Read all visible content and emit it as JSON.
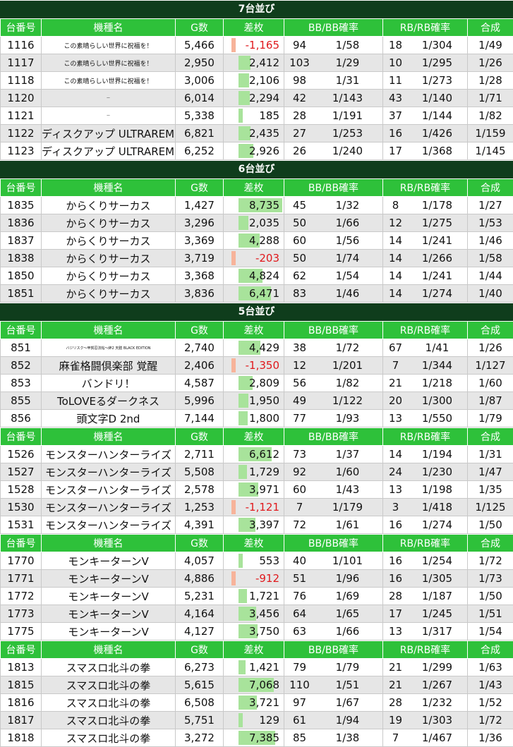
{
  "headers": {
    "no": "台番号",
    "name": "機種名",
    "games": "G数",
    "diff": "差枚",
    "bb": "BB/BB確率",
    "rb": "RB/RB確率",
    "total": "合成"
  },
  "colors": {
    "header_green": "#2ec13a",
    "section_dark": "#0f3d1c",
    "positive_bar": "#a8e39b",
    "negative_bar": "#f7b39a",
    "negative_text": "#e0181c"
  },
  "diff_scale_max": 8735,
  "sections": [
    {
      "title": "7台並び",
      "groups": [
        {
          "rows": [
            {
              "no": "1116",
              "name": "この素晴らしい世界に祝福を！",
              "size": "small",
              "g": "5,466",
              "diff": "-1,165",
              "bb": "94",
              "bbr": "1/58",
              "rb": "18",
              "rbr": "1/304",
              "tot": "1/49"
            },
            {
              "no": "1117",
              "name": "この素晴らしい世界に祝福を！",
              "size": "small",
              "g": "2,950",
              "diff": "2,412",
              "bb": "103",
              "bbr": "1/29",
              "rb": "10",
              "rbr": "1/295",
              "tot": "1/26"
            },
            {
              "no": "1118",
              "name": "この素晴らしい世界に祝福を！",
              "size": "small",
              "g": "3,006",
              "diff": "2,106",
              "bb": "98",
              "bbr": "1/31",
              "rb": "11",
              "rbr": "1/273",
              "tot": "1/28"
            },
            {
              "no": "1120",
              "name": "ー",
              "size": "tiny",
              "g": "6,014",
              "diff": "2,294",
              "bb": "42",
              "bbr": "1/143",
              "rb": "43",
              "rbr": "1/140",
              "tot": "1/71"
            },
            {
              "no": "1121",
              "name": "ー",
              "size": "tiny",
              "g": "5,338",
              "diff": "185",
              "bb": "28",
              "bbr": "1/191",
              "rb": "37",
              "rbr": "1/144",
              "tot": "1/82"
            },
            {
              "no": "1122",
              "name": "ディスクアップ ULTRAREMIX",
              "size": "",
              "g": "6,821",
              "diff": "2,435",
              "bb": "27",
              "bbr": "1/253",
              "rb": "16",
              "rbr": "1/426",
              "tot": "1/159"
            },
            {
              "no": "1123",
              "name": "ディスクアップ ULTRAREMIX",
              "size": "",
              "g": "6,252",
              "diff": "2,926",
              "bb": "26",
              "bbr": "1/240",
              "rb": "17",
              "rbr": "1/368",
              "tot": "1/145"
            }
          ]
        }
      ]
    },
    {
      "title": "6台並び",
      "groups": [
        {
          "rows": [
            {
              "no": "1835",
              "name": "からくりサーカス",
              "size": "",
              "g": "1,427",
              "diff": "8,735",
              "bb": "45",
              "bbr": "1/32",
              "rb": "8",
              "rbr": "1/178",
              "tot": "1/27"
            },
            {
              "no": "1836",
              "name": "からくりサーカス",
              "size": "",
              "g": "3,296",
              "diff": "2,035",
              "bb": "50",
              "bbr": "1/66",
              "rb": "12",
              "rbr": "1/275",
              "tot": "1/53"
            },
            {
              "no": "1837",
              "name": "からくりサーカス",
              "size": "",
              "g": "3,369",
              "diff": "4,288",
              "bb": "60",
              "bbr": "1/56",
              "rb": "14",
              "rbr": "1/241",
              "tot": "1/46"
            },
            {
              "no": "1838",
              "name": "からくりサーカス",
              "size": "",
              "g": "3,719",
              "diff": "-203",
              "bb": "50",
              "bbr": "1/74",
              "rb": "14",
              "rbr": "1/266",
              "tot": "1/58"
            },
            {
              "no": "1850",
              "name": "からくりサーカス",
              "size": "",
              "g": "3,368",
              "diff": "4,824",
              "bb": "62",
              "bbr": "1/54",
              "rb": "14",
              "rbr": "1/241",
              "tot": "1/44"
            },
            {
              "no": "1851",
              "name": "からくりサーカス",
              "size": "",
              "g": "3,836",
              "diff": "6,471",
              "bb": "83",
              "bbr": "1/46",
              "rb": "14",
              "rbr": "1/274",
              "tot": "1/40"
            }
          ]
        }
      ]
    },
    {
      "title": "5台並び",
      "groups": [
        {
          "rows": [
            {
              "no": "851",
              "name": "バジリスク～甲賀忍法帖～絆2 天膳 BLACK EDITION",
              "size": "tiny",
              "g": "2,740",
              "diff": "4,429",
              "bb": "38",
              "bbr": "1/72",
              "rb": "67",
              "rbr": "1/41",
              "tot": "1/26"
            },
            {
              "no": "852",
              "name": "麻雀格闘倶楽部 覚醒",
              "size": "",
              "g": "2,406",
              "diff": "-1,350",
              "bb": "12",
              "bbr": "1/201",
              "rb": "7",
              "rbr": "1/344",
              "tot": "1/127"
            },
            {
              "no": "853",
              "name": "バンドリ！",
              "size": "",
              "g": "4,587",
              "diff": "2,809",
              "bb": "56",
              "bbr": "1/82",
              "rb": "21",
              "rbr": "1/218",
              "tot": "1/60"
            },
            {
              "no": "855",
              "name": "ToLOVEるダークネス",
              "size": "",
              "g": "5,996",
              "diff": "1,950",
              "bb": "49",
              "bbr": "1/122",
              "rb": "20",
              "rbr": "1/300",
              "tot": "1/87"
            },
            {
              "no": "856",
              "name": "頭文字D 2nd",
              "size": "",
              "g": "7,144",
              "diff": "1,800",
              "bb": "77",
              "bbr": "1/93",
              "rb": "13",
              "rbr": "1/550",
              "tot": "1/79"
            }
          ]
        },
        {
          "rows": [
            {
              "no": "1526",
              "name": "モンスターハンターライズ",
              "size": "",
              "g": "2,711",
              "diff": "6,612",
              "bb": "73",
              "bbr": "1/37",
              "rb": "14",
              "rbr": "1/194",
              "tot": "1/31"
            },
            {
              "no": "1527",
              "name": "モンスターハンターライズ",
              "size": "",
              "g": "5,508",
              "diff": "1,729",
              "bb": "92",
              "bbr": "1/60",
              "rb": "24",
              "rbr": "1/230",
              "tot": "1/47"
            },
            {
              "no": "1528",
              "name": "モンスターハンターライズ",
              "size": "",
              "g": "2,578",
              "diff": "3,971",
              "bb": "60",
              "bbr": "1/43",
              "rb": "13",
              "rbr": "1/198",
              "tot": "1/35"
            },
            {
              "no": "1530",
              "name": "モンスターハンターライズ",
              "size": "",
              "g": "1,253",
              "diff": "-1,121",
              "bb": "7",
              "bbr": "1/179",
              "rb": "3",
              "rbr": "1/418",
              "tot": "1/125"
            },
            {
              "no": "1531",
              "name": "モンスターハンターライズ",
              "size": "",
              "g": "4,391",
              "diff": "3,397",
              "bb": "72",
              "bbr": "1/61",
              "rb": "16",
              "rbr": "1/274",
              "tot": "1/50"
            }
          ]
        },
        {
          "rows": [
            {
              "no": "1770",
              "name": "モンキーターンV",
              "size": "",
              "g": "4,057",
              "diff": "553",
              "bb": "40",
              "bbr": "1/101",
              "rb": "16",
              "rbr": "1/254",
              "tot": "1/72"
            },
            {
              "no": "1771",
              "name": "モンキーターンV",
              "size": "",
              "g": "4,886",
              "diff": "-912",
              "bb": "51",
              "bbr": "1/96",
              "rb": "16",
              "rbr": "1/305",
              "tot": "1/73"
            },
            {
              "no": "1772",
              "name": "モンキーターンV",
              "size": "",
              "g": "5,231",
              "diff": "1,721",
              "bb": "76",
              "bbr": "1/69",
              "rb": "28",
              "rbr": "1/187",
              "tot": "1/50"
            },
            {
              "no": "1773",
              "name": "モンキーターンV",
              "size": "",
              "g": "4,164",
              "diff": "3,456",
              "bb": "64",
              "bbr": "1/65",
              "rb": "17",
              "rbr": "1/245",
              "tot": "1/51"
            },
            {
              "no": "1775",
              "name": "モンキーターンV",
              "size": "",
              "g": "4,127",
              "diff": "3,750",
              "bb": "63",
              "bbr": "1/66",
              "rb": "13",
              "rbr": "1/317",
              "tot": "1/54"
            }
          ]
        },
        {
          "rows": [
            {
              "no": "1813",
              "name": "スマスロ北斗の拳",
              "size": "",
              "g": "6,273",
              "diff": "1,421",
              "bb": "79",
              "bbr": "1/79",
              "rb": "21",
              "rbr": "1/299",
              "tot": "1/63"
            },
            {
              "no": "1815",
              "name": "スマスロ北斗の拳",
              "size": "",
              "g": "5,615",
              "diff": "7,068",
              "bb": "110",
              "bbr": "1/51",
              "rb": "21",
              "rbr": "1/267",
              "tot": "1/43"
            },
            {
              "no": "1816",
              "name": "スマスロ北斗の拳",
              "size": "",
              "g": "6,508",
              "diff": "3,721",
              "bb": "97",
              "bbr": "1/67",
              "rb": "28",
              "rbr": "1/232",
              "tot": "1/52"
            },
            {
              "no": "1817",
              "name": "スマスロ北斗の拳",
              "size": "",
              "g": "5,751",
              "diff": "129",
              "bb": "61",
              "bbr": "1/94",
              "rb": "19",
              "rbr": "1/303",
              "tot": "1/72"
            },
            {
              "no": "1818",
              "name": "スマスロ北斗の拳",
              "size": "",
              "g": "3,272",
              "diff": "7,385",
              "bb": "85",
              "bbr": "1/38",
              "rb": "7",
              "rbr": "1/467",
              "tot": "1/36"
            }
          ]
        }
      ]
    }
  ]
}
